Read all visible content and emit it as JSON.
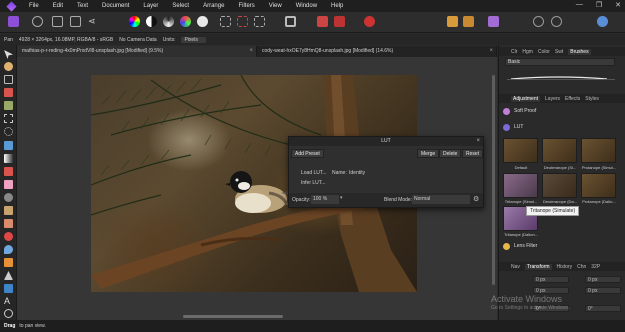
{
  "menu": {
    "items": [
      "File",
      "Edit",
      "Text",
      "Document",
      "Layer",
      "Select",
      "Arrange",
      "Filters",
      "View",
      "Window",
      "Help"
    ]
  },
  "context": {
    "pan_label": "Pan",
    "doc_info": "4928 × 3264px, 16.08MP, RGBA/8 - sRGB",
    "camera": "No Camera Data",
    "units_label": "Units:",
    "units_value": "Pixels"
  },
  "documents": {
    "tabs": [
      {
        "title": "mathias-p-r-reding-4x0mPrxdVl8-unsplash.jpg [Modified] (9.5%)"
      },
      {
        "title": "cody-weat-hxOE7y8HmQ8-unsplash.jpg [Modified] (14.6%)"
      }
    ]
  },
  "lut_dialog": {
    "title": "LUT",
    "add_preset": "Add Preset",
    "merge": "Merge",
    "delete": "Delete",
    "reset": "Reset",
    "load_lut": "Load LUT...",
    "name_label": "Name:",
    "name_value": "Identity",
    "infer_lut": "Infer LUT...",
    "opacity_label": "Opacity:",
    "opacity_value": "100 %",
    "blend_label": "Blend Mode:",
    "blend_value": "Normal"
  },
  "right_panel": {
    "top_tabs": [
      "Clr",
      "Hgm",
      "Color",
      "Swt",
      "Brushes"
    ],
    "brush_category": "Basic",
    "mid_tabs": [
      "Adjustment",
      "Layers",
      "Effects",
      "Styles"
    ],
    "adjustments": [
      {
        "label": "Soft Proof",
        "color": "#c07fd8"
      },
      {
        "label": "LUT",
        "color": "#7b6bd8"
      }
    ],
    "presets": [
      {
        "label": "Default"
      },
      {
        "label": "Deuteranope (Si..."
      },
      {
        "label": "Protanope (Simul..."
      },
      {
        "label": "Tritanope (Simul..."
      },
      {
        "label": "Deuteranope (Da..."
      },
      {
        "label": "Protanope (Daltо..."
      },
      {
        "label": "Tritanope (Dalton..."
      }
    ],
    "lens_filter": "Lens Filter",
    "bottom_tabs": [
      "Nav",
      "Transform",
      "History",
      "Chn",
      "32P"
    ],
    "transform_fields": [
      "0 px",
      "0 px",
      "0 px",
      "0 px",
      "0°",
      "0°"
    ]
  },
  "tooltip": "Tritanope (Simulate)",
  "status": {
    "key": "Drag",
    "hint": "to pan view."
  },
  "watermark": {
    "title": "Activate Windows",
    "sub": "Go to Settings to activate Windows."
  }
}
